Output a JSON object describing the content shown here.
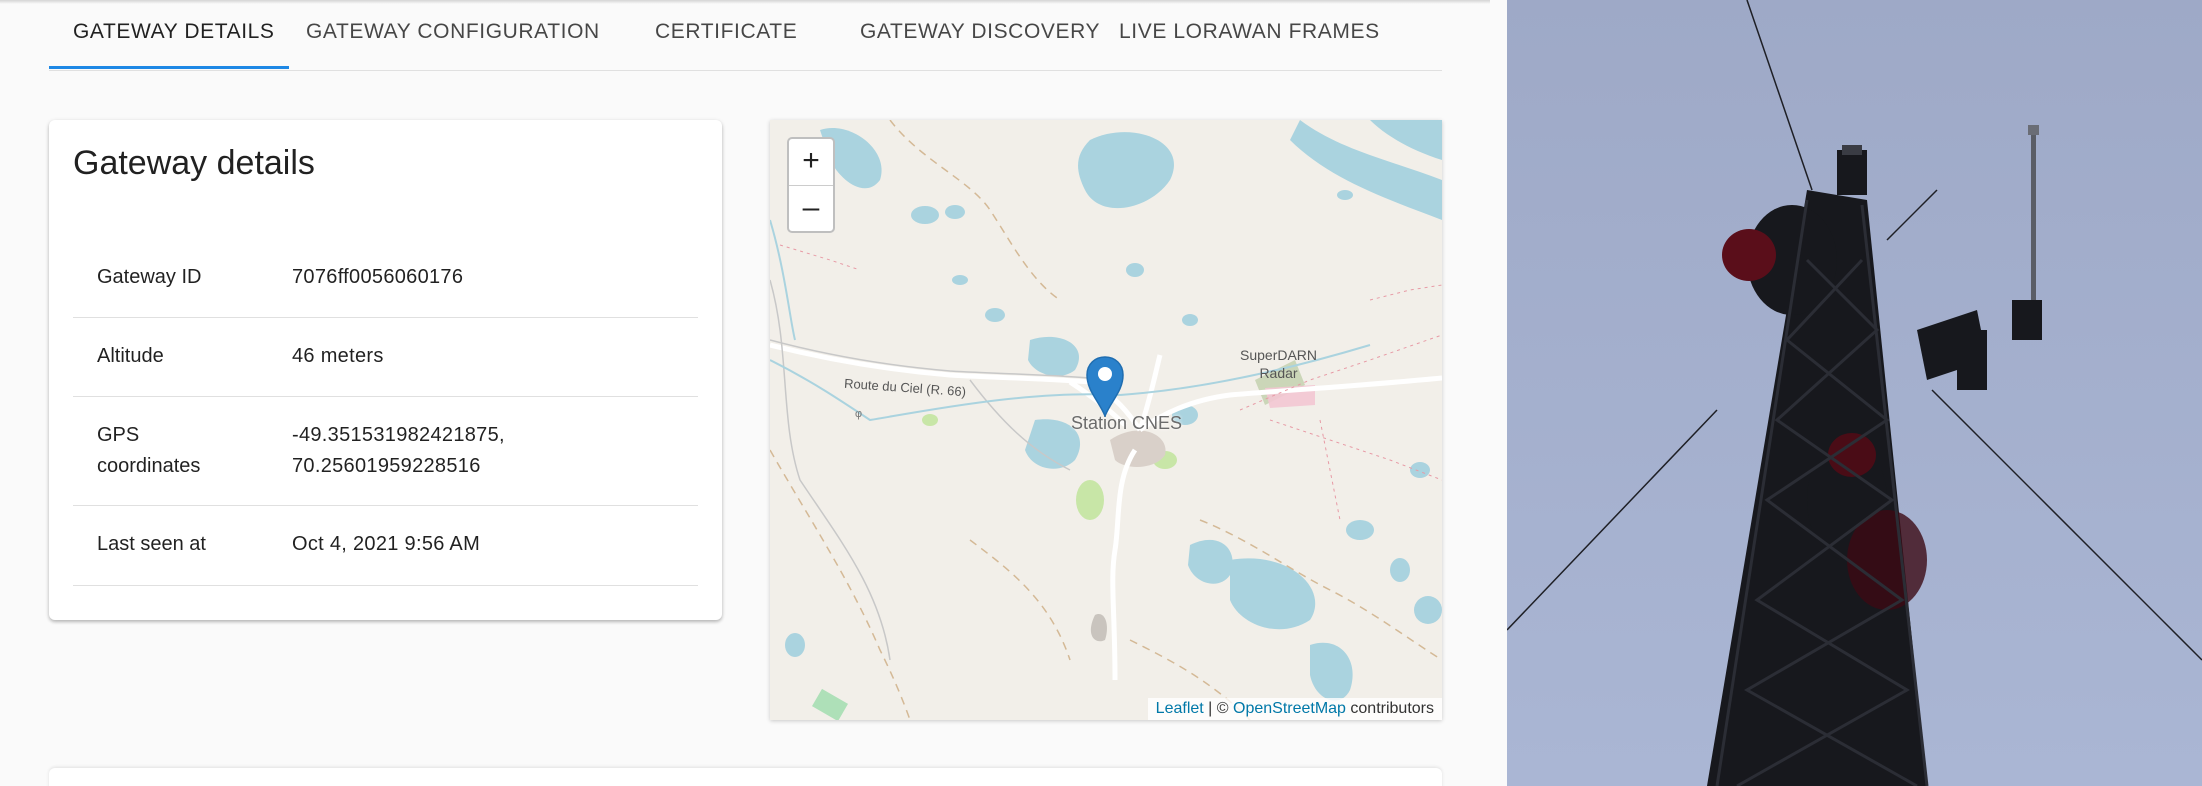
{
  "tabs": [
    {
      "label": "GATEWAY DETAILS",
      "active": true
    },
    {
      "label": "GATEWAY CONFIGURATION",
      "active": false
    },
    {
      "label": "CERTIFICATE",
      "active": false
    },
    {
      "label": "GATEWAY DISCOVERY",
      "active": false
    },
    {
      "label": "LIVE LORAWAN FRAMES",
      "active": false
    }
  ],
  "details": {
    "title": "Gateway details",
    "rows": [
      {
        "label": "Gateway ID",
        "value": "7076ff0056060176"
      },
      {
        "label": "Altitude",
        "value": "46 meters"
      },
      {
        "label_line1": "GPS",
        "label_line2": "coordinates",
        "value_line1": "-49.351531982421875,",
        "value_line2": "70.25601959228516"
      },
      {
        "label": "Last seen at",
        "value": "Oct 4, 2021 9:56 AM"
      }
    ]
  },
  "map": {
    "zoom_in": "+",
    "zoom_out": "–",
    "labels": {
      "road": "Route du Ciel (R. 66)",
      "station": "Station CNES",
      "radar_line1": "SuperDARN",
      "radar_line2": "Radar"
    },
    "attribution": {
      "leaflet": "Leaflet",
      "sep": " | © ",
      "osm": "OpenStreetMap",
      "suffix": " contributors"
    },
    "colors": {
      "land": "#f2efe9",
      "water": "#aad3df",
      "marker": "#2a81cb"
    }
  },
  "icons": {
    "map_marker": "map-marker-icon",
    "antenna": "antenna-icon"
  }
}
